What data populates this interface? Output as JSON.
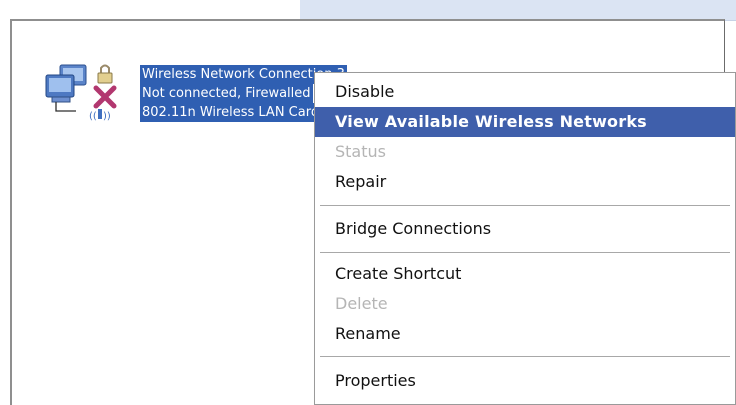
{
  "connection": {
    "name": "Wireless Network Connection 3",
    "status": "Not connected, Firewalled",
    "device": "802.11n Wireless LAN Card"
  },
  "menu": {
    "disable": "Disable",
    "view_networks": "View Available Wireless Networks",
    "status": "Status",
    "repair": "Repair",
    "bridge": "Bridge Connections",
    "create_shortcut": "Create Shortcut",
    "delete": "Delete",
    "rename": "Rename",
    "properties": "Properties"
  },
  "colors": {
    "selection": "#2f5fb2",
    "menu_highlight": "#3f5fab",
    "disabled_text": "#b5b5b5"
  },
  "icons": {
    "connection": "wireless-network-computers-icon",
    "status_overlay": "disconnected-x-icon",
    "antenna": "wireless-antenna-icon",
    "lock": "firewall-lock-icon"
  }
}
